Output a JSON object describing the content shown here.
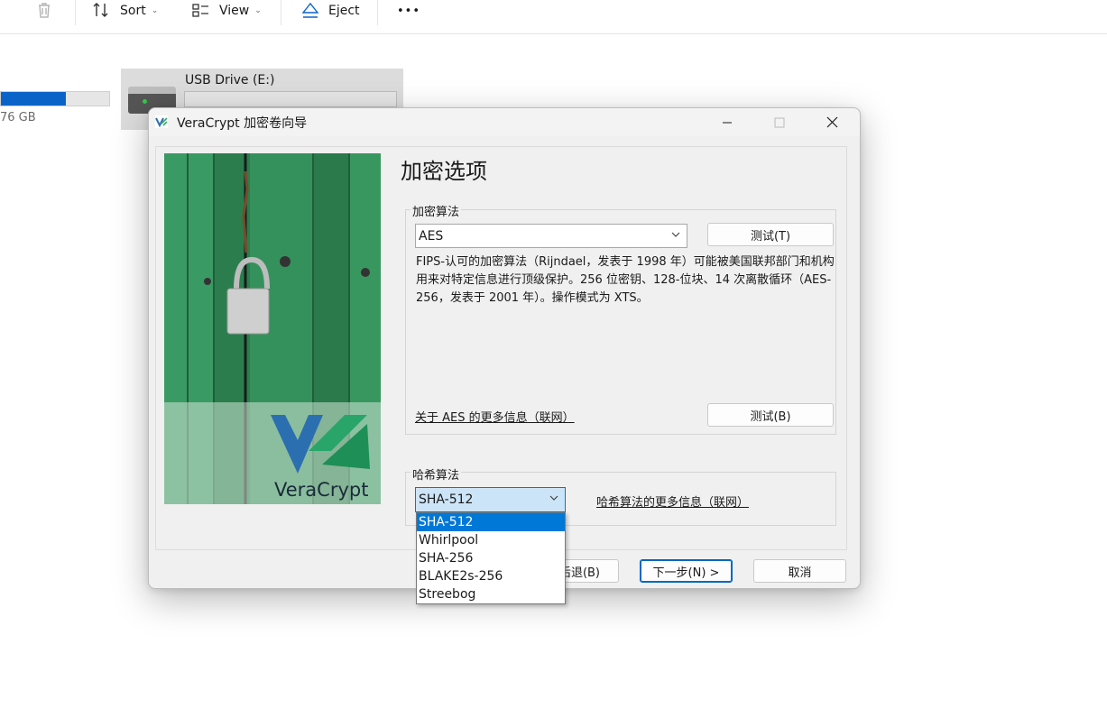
{
  "explorer": {
    "toolbar": {
      "sort_label": "Sort",
      "view_label": "View",
      "eject_label": "Eject",
      "more_label": "•••"
    },
    "left_drive": {
      "size_text": "76 GB",
      "used_fraction": 0.6
    },
    "usb_drive": {
      "name": "USB Drive (E:)",
      "used_fraction": 0.0
    }
  },
  "dialog": {
    "title": "VeraCrypt 加密卷向导",
    "page_title": "加密选项",
    "image_brand_text": "VeraCrypt",
    "encryption": {
      "group_label": "加密算法",
      "selected_algorithm": "AES",
      "test_button": "测试(T)",
      "description": "FIPS-认可的加密算法（Rijndael，发表于 1998 年）可能被美国联邦部门和机构用来对特定信息进行顶级保护。256 位密钥、128-位块、14 次离散循环（AES-256，发表于 2001 年）。操作模式为 XTS。",
      "more_info_link": "关于 AES 的更多信息（联网）",
      "benchmark_button": "测试(B)"
    },
    "hash": {
      "group_label": "哈希算法",
      "selected": "SHA-512",
      "more_info_link": "哈希算法的更多信息（联网）",
      "options": [
        "SHA-512",
        "Whirlpool",
        "SHA-256",
        "BLAKE2s-256",
        "Streebog"
      ],
      "highlighted_index": 0
    },
    "buttons": {
      "back_partial": "后退(B)",
      "next": "下一步(N) >",
      "cancel": "取消"
    },
    "colors": {
      "accent": "#0078d7",
      "selected_combo_bg": "#cce4f7"
    }
  }
}
